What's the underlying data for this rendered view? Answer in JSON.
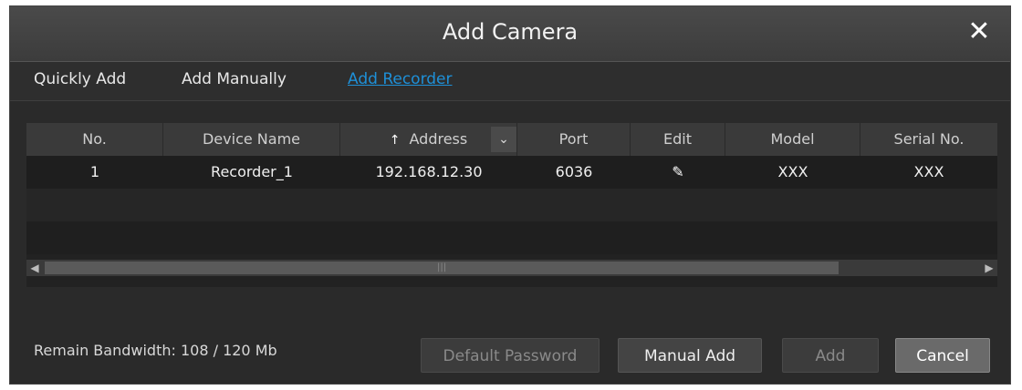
{
  "dialog": {
    "title": "Add Camera",
    "close_glyph": "✕"
  },
  "tabs": [
    {
      "label": "Quickly Add",
      "active": false
    },
    {
      "label": "Add Manually",
      "active": false
    },
    {
      "label": "Add Recorder",
      "active": true
    }
  ],
  "table": {
    "columns": [
      "No.",
      "Device Name",
      "Address",
      "Port",
      "Edit",
      "Model",
      "Serial No."
    ],
    "sort_glyph": "↑",
    "dropdown_glyph": "⌄",
    "rows": [
      {
        "no": "1",
        "device_name": "Recorder_1",
        "address": "192.168.12.30",
        "port": "6036",
        "edit_icon": "pencil-icon",
        "model": "XXX",
        "serial": "XXX"
      }
    ]
  },
  "footer": {
    "bandwidth": "Remain Bandwidth: 108 / 120 Mb",
    "buttons": {
      "default_password": "Default Password",
      "manual_add": "Manual Add",
      "add": "Add",
      "cancel": "Cancel"
    }
  },
  "colors": {
    "accent": "#1e90d8",
    "background": "#2a2a2a",
    "header": "#3a3a3a"
  }
}
